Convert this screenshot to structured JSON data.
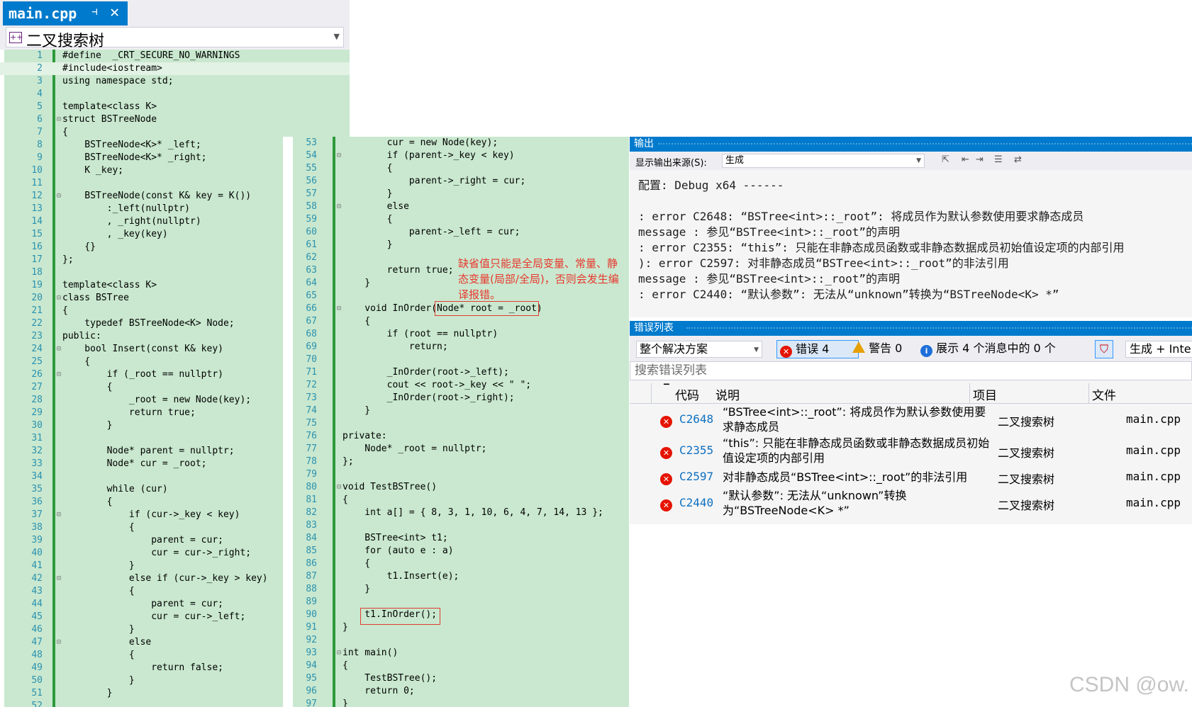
{
  "editor": {
    "tab_title": "main.cpp",
    "tab_pin_icon": "⊣",
    "tab_close_icon": "✕",
    "member_dropdown": "二叉搜索树"
  },
  "code_left": [
    {
      "no": "1",
      "text": "#define  _CRT_SECURE_NO_WARNINGS"
    },
    {
      "no": "2",
      "text": "#include<iostream>"
    },
    {
      "no": "3",
      "text": "using namespace std;"
    },
    {
      "no": "4",
      "text": ""
    },
    {
      "no": "5",
      "text": "template<class K>"
    },
    {
      "no": "6",
      "text": "struct BSTreeNode",
      "fold": "-"
    },
    {
      "no": "7",
      "text": "{"
    },
    {
      "no": "8",
      "text": "    BSTreeNode<K>* _left;"
    },
    {
      "no": "9",
      "text": "    BSTreeNode<K>* _right;"
    },
    {
      "no": "10",
      "text": "    K _key;"
    },
    {
      "no": "11",
      "text": ""
    },
    {
      "no": "12",
      "text": "    BSTreeNode(const K& key = K())",
      "fold": "-"
    },
    {
      "no": "13",
      "text": "        :_left(nullptr)"
    },
    {
      "no": "14",
      "text": "        , _right(nullptr)"
    },
    {
      "no": "15",
      "text": "        , _key(key)"
    },
    {
      "no": "16",
      "text": "    {}"
    },
    {
      "no": "17",
      "text": "};"
    },
    {
      "no": "18",
      "text": ""
    },
    {
      "no": "19",
      "text": "template<class K>"
    },
    {
      "no": "20",
      "text": "class BSTree",
      "fold": "-"
    },
    {
      "no": "21",
      "text": "{"
    },
    {
      "no": "22",
      "text": "    typedef BSTreeNode<K> Node;"
    },
    {
      "no": "23",
      "text": "public:"
    },
    {
      "no": "24",
      "text": "    bool Insert(const K& key)",
      "fold": "-"
    },
    {
      "no": "25",
      "text": "    {"
    },
    {
      "no": "26",
      "text": "        if (_root == nullptr)",
      "fold": "-"
    },
    {
      "no": "27",
      "text": "        {"
    },
    {
      "no": "28",
      "text": "            _root = new Node(key);"
    },
    {
      "no": "29",
      "text": "            return true;"
    },
    {
      "no": "30",
      "text": "        }"
    },
    {
      "no": "31",
      "text": ""
    },
    {
      "no": "32",
      "text": "        Node* parent = nullptr;"
    },
    {
      "no": "33",
      "text": "        Node* cur = _root;"
    },
    {
      "no": "34",
      "text": ""
    },
    {
      "no": "35",
      "text": "        while (cur)"
    },
    {
      "no": "36",
      "text": "        {"
    },
    {
      "no": "37",
      "text": "            if (cur->_key < key)",
      "fold": "-"
    },
    {
      "no": "38",
      "text": "            {"
    },
    {
      "no": "39",
      "text": "                parent = cur;"
    },
    {
      "no": "40",
      "text": "                cur = cur->_right;"
    },
    {
      "no": "41",
      "text": "            }"
    },
    {
      "no": "42",
      "text": "            else if (cur->_key > key)",
      "fold": "-"
    },
    {
      "no": "43",
      "text": "            {"
    },
    {
      "no": "44",
      "text": "                parent = cur;"
    },
    {
      "no": "45",
      "text": "                cur = cur->_left;"
    },
    {
      "no": "46",
      "text": "            }"
    },
    {
      "no": "47",
      "text": "            else",
      "fold": "-"
    },
    {
      "no": "48",
      "text": "            {"
    },
    {
      "no": "49",
      "text": "                return false;"
    },
    {
      "no": "50",
      "text": "            }"
    },
    {
      "no": "51",
      "text": "        }"
    },
    {
      "no": "52",
      "text": ""
    }
  ],
  "code_right": [
    {
      "no": "53",
      "text": "        cur = new Node(key);"
    },
    {
      "no": "54",
      "text": "        if (parent->_key < key)",
      "fold": "-"
    },
    {
      "no": "55",
      "text": "        {"
    },
    {
      "no": "56",
      "text": "            parent->_right = cur;"
    },
    {
      "no": "57",
      "text": "        }"
    },
    {
      "no": "58",
      "text": "        else",
      "fold": "-"
    },
    {
      "no": "59",
      "text": "        {"
    },
    {
      "no": "60",
      "text": "            parent->_left = cur;"
    },
    {
      "no": "61",
      "text": "        }"
    },
    {
      "no": "62",
      "text": ""
    },
    {
      "no": "63",
      "text": "        return true;"
    },
    {
      "no": "64",
      "text": "    }"
    },
    {
      "no": "65",
      "text": ""
    },
    {
      "no": "66",
      "text": "    void InOrder(Node* root = _root)",
      "fold": "-"
    },
    {
      "no": "67",
      "text": "    {"
    },
    {
      "no": "68",
      "text": "        if (root == nullptr)"
    },
    {
      "no": "69",
      "text": "            return;"
    },
    {
      "no": "70",
      "text": ""
    },
    {
      "no": "71",
      "text": "        _InOrder(root->_left);"
    },
    {
      "no": "72",
      "text": "        cout << root->_key << \" \";"
    },
    {
      "no": "73",
      "text": "        _InOrder(root->_right);"
    },
    {
      "no": "74",
      "text": "    }"
    },
    {
      "no": "75",
      "text": ""
    },
    {
      "no": "76",
      "text": "private:"
    },
    {
      "no": "77",
      "text": "    Node* _root = nullptr;"
    },
    {
      "no": "78",
      "text": "};"
    },
    {
      "no": "79",
      "text": ""
    },
    {
      "no": "80",
      "text": "void TestBSTree()",
      "fold": "-"
    },
    {
      "no": "81",
      "text": "{"
    },
    {
      "no": "82",
      "text": "    int a[] = { 8, 3, 1, 10, 6, 4, 7, 14, 13 };"
    },
    {
      "no": "83",
      "text": ""
    },
    {
      "no": "84",
      "text": "    BSTree<int> t1;"
    },
    {
      "no": "85",
      "text": "    for (auto e : a)"
    },
    {
      "no": "86",
      "text": "    {"
    },
    {
      "no": "87",
      "text": "        t1.Insert(e);"
    },
    {
      "no": "88",
      "text": "    }"
    },
    {
      "no": "89",
      "text": ""
    },
    {
      "no": "90",
      "text": "    t1.InOrder();"
    },
    {
      "no": "91",
      "text": "}"
    },
    {
      "no": "92",
      "text": ""
    },
    {
      "no": "93",
      "text": "int main()",
      "fold": "-"
    },
    {
      "no": "94",
      "text": "{"
    },
    {
      "no": "95",
      "text": "    TestBSTree();"
    },
    {
      "no": "96",
      "text": "    return 0;"
    },
    {
      "no": "97",
      "text": "}"
    }
  ],
  "annotation": "缺省值只能是全局变量、常量、静态变量(局部/全局)，否则会发生编译报错。",
  "output": {
    "title": "输出",
    "source_label": "显示输出来源(S):",
    "source_value": "生成",
    "lines": [
      "配置: Debug x64 ------",
      "",
      ": error C2648: “BSTree<int>::_root”: 将成员作为默认参数使用要求静态成员",
      "message : 参见“BSTree<int>::_root”的声明",
      ": error C2355: “this”: 只能在非静态成员函数或非静态数据成员初始值设定项的内部引用",
      "): error C2597: 对非静态成员“BSTree<int>::_root”的非法引用",
      "message : 参见“BSTree<int>::_root”的声明",
      ": error C2440: “默认参数”: 无法从“unknown”转换为“BSTreeNode<K> *”"
    ]
  },
  "error_list": {
    "title": "错误列表",
    "scope": "整个解决方案",
    "errors_label": "错误 4",
    "warnings_label": "警告 0",
    "messages_label": "展示 4 个消息中的 0 个",
    "build_filter": "生成 + IntelliSense",
    "search_placeholder": "搜索错误列表",
    "columns": {
      "code": "代码",
      "desc": "说明",
      "project": "项目",
      "file": "文件"
    },
    "rows": [
      {
        "code": "C2648",
        "desc": "“BSTree<int>::_root”: 将成员作为默认参数使用要求静态成员",
        "project": "二叉搜索树",
        "file": "main.cpp"
      },
      {
        "code": "C2355",
        "desc": "“this”: 只能在非静态成员函数或非静态数据成员初始值设定项的内部引用",
        "project": "二叉搜索树",
        "file": "main.cpp"
      },
      {
        "code": "C2597",
        "desc": "对非静态成员“BSTree<int>::_root”的非法引用",
        "project": "二叉搜索树",
        "file": "main.cpp"
      },
      {
        "code": "C2440",
        "desc": "“默认参数”: 无法从“unknown”转换为“BSTreeNode<K> *”",
        "project": "二叉搜索树",
        "file": "main.cpp"
      }
    ]
  },
  "watermark": "CSDN @ow."
}
